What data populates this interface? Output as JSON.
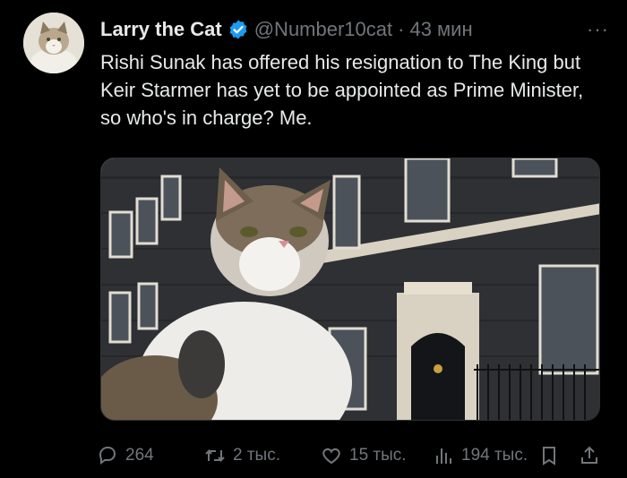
{
  "author": {
    "name": "Larry the Cat",
    "handle": "@Number10cat",
    "separator": "·",
    "time": "43 мин"
  },
  "more_label": "···",
  "tweet": {
    "text": "Rishi Sunak has offered his resignation to The King but Keir Starmer has yet to be appointed as Prime Minister, so who's in charge? Me."
  },
  "actions": {
    "replies": "264",
    "retweets": "2 тыс.",
    "likes": "15 тыс.",
    "views": "194 тыс."
  },
  "icons": {
    "verified": "verified-badge-icon",
    "reply": "reply-icon",
    "retweet": "retweet-icon",
    "like": "heart-icon",
    "views": "views-bar-chart-icon",
    "bookmark": "bookmark-icon",
    "share": "share-icon"
  },
  "colors": {
    "background": "#000000",
    "text": "#e7e9ea",
    "muted": "#71767b",
    "verified": "#1d9bf0"
  }
}
